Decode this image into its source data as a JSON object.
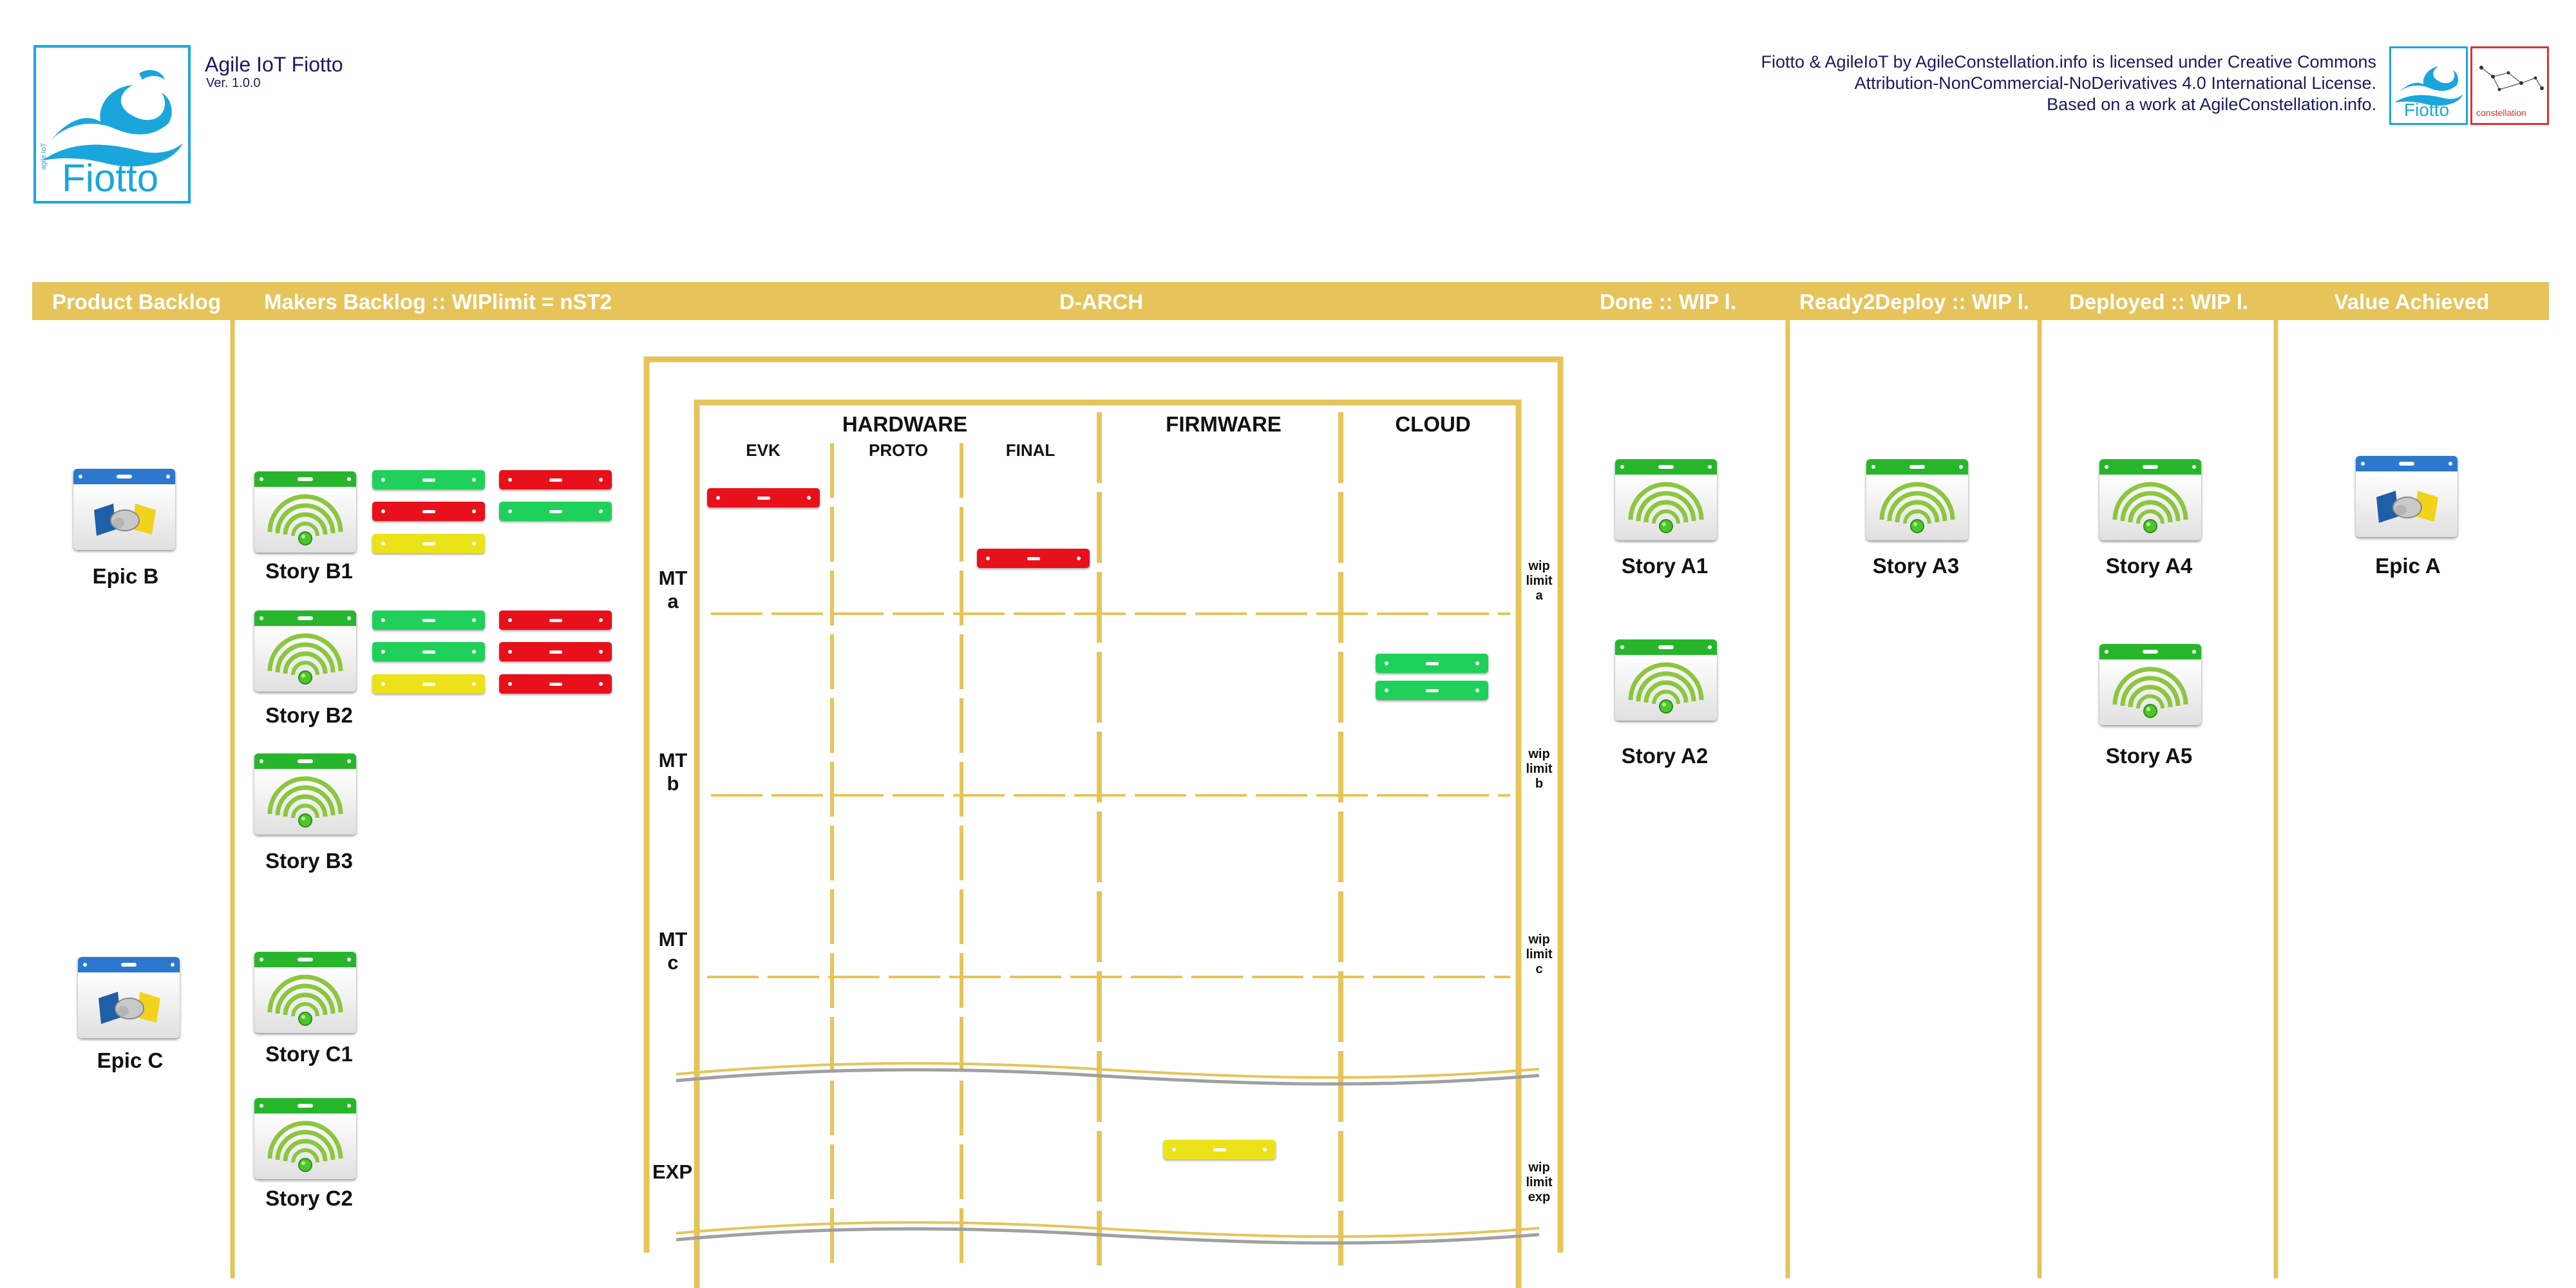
{
  "app": {
    "title": "Agile IoT Fiotto",
    "version": "Ver. 1.0.0",
    "logo_text": "Fiotto",
    "logo_small_text": "agile IoT",
    "license_lines": [
      "Fiotto & AgileIoT by AgileConstellation.info is licensed under Creative Commons",
      "Attribution-NonCommercial-NoDerivatives 4.0 International License.",
      "Based on a work at AgileConstellation.info."
    ],
    "mini_logo_fiotto": "Fiotto",
    "mini_logo_constellation": "constellation"
  },
  "columns": {
    "product_backlog": "Product Backlog",
    "makers_backlog": "Makers Backlog :: WIPlimit = nST2",
    "d_arch": "D-ARCH",
    "done": "Done :: WIP l.",
    "ready2deploy": "Ready2Deploy :: WIP l.",
    "deployed": "Deployed :: WIP l.",
    "value_achieved": "Value Achieved"
  },
  "darch": {
    "hardware": "HARDWARE",
    "firmware": "FIRMWARE",
    "cloud": "CLOUD",
    "sub": {
      "evk": "EVK",
      "proto": "PROTO",
      "final": "FINAL"
    },
    "rows": [
      {
        "label": "MT\na",
        "wip": "wip\nlimit\na"
      },
      {
        "label": "MT\nb",
        "wip": "wip\nlimit\nb"
      },
      {
        "label": "MT\nc",
        "wip": "wip\nlimit\nc"
      },
      {
        "label": "EXP",
        "wip": "wip\nlimit\nexp"
      }
    ]
  },
  "cards": {
    "epic_b": "Epic B",
    "epic_c": "Epic C",
    "epic_a": "Epic A",
    "story_b1": "Story B1",
    "story_b2": "Story B2",
    "story_b3": "Story B3",
    "story_c1": "Story C1",
    "story_c2": "Story C2",
    "story_a1": "Story A1",
    "story_a2": "Story A2",
    "story_a3": "Story A3",
    "story_a4": "Story A4",
    "story_a5": "Story A5"
  },
  "colors": {
    "header_bar": "#e6c45a",
    "ticket_red": "#e8101a",
    "ticket_green": "#1fd15a",
    "ticket_yellow": "#ece21a",
    "story_header": "#27b62b",
    "epic_header": "#2c78cf",
    "logo_blue": "#1aa6dd",
    "logo_red": "#e03030"
  },
  "icons": {
    "story": "wifi-icon",
    "epic": "handshake-icon",
    "logo": "wave-icon"
  }
}
